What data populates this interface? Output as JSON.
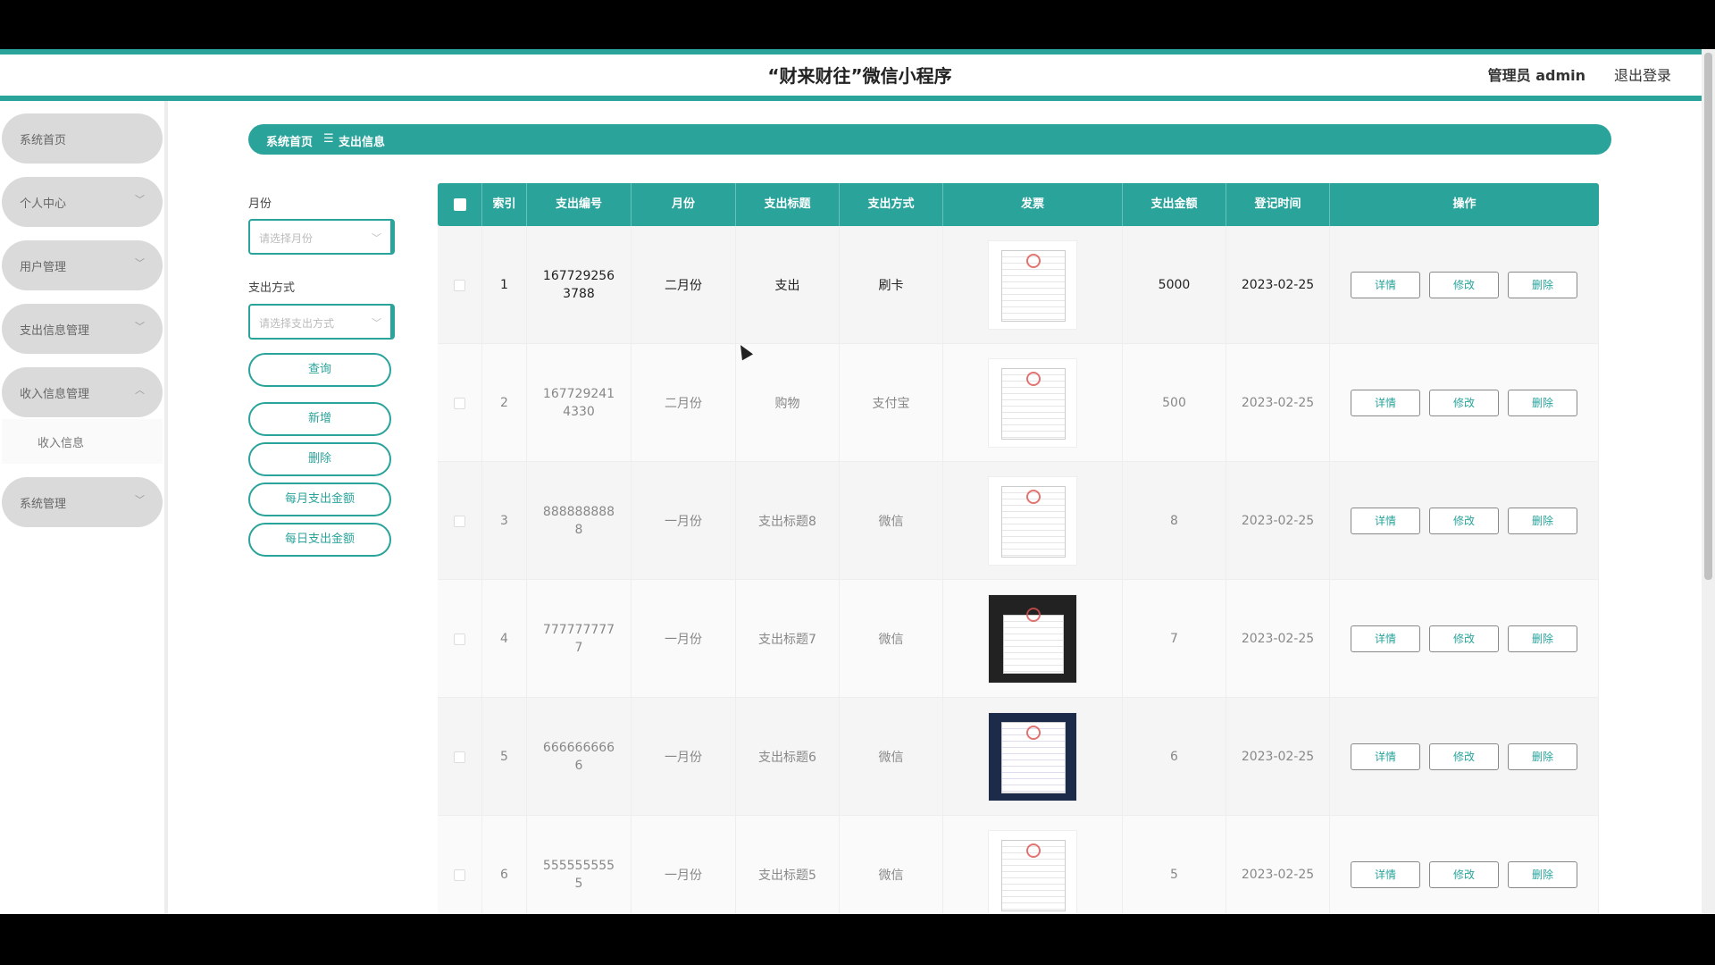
{
  "header": {
    "title": "“财来财往”微信小程序",
    "admin": "管理员 admin",
    "logout": "退出登录"
  },
  "sidebar": {
    "items": [
      {
        "label": "系统首页",
        "chevron": ""
      },
      {
        "label": "个人中心",
        "chevron": "﹀"
      },
      {
        "label": "用户管理",
        "chevron": "﹀"
      },
      {
        "label": "支出信息管理",
        "chevron": "﹀"
      },
      {
        "label": "收入信息管理",
        "chevron": "︿"
      },
      {
        "label": "系统管理",
        "chevron": "﹀"
      }
    ],
    "sub": {
      "label": "收入信息"
    }
  },
  "breadcrumb": {
    "home": "系统首页",
    "sep": "☰",
    "current": "支出信息"
  },
  "filters": {
    "month_label": "月份",
    "month_placeholder": "请选择月份",
    "method_label": "支出方式",
    "method_placeholder": "请选择支出方式",
    "arrow": "﹀",
    "buttons": {
      "query": "查询",
      "add": "新增",
      "delete": "删除",
      "monthly": "每月支出金额",
      "daily": "每日支出金额"
    }
  },
  "table": {
    "headers": {
      "index": "索引",
      "number": "支出编号",
      "month": "月份",
      "title": "支出标题",
      "method": "支出方式",
      "invoice": "发票",
      "amount": "支出金额",
      "time": "登记时间",
      "actions": "操作"
    },
    "actions": {
      "detail": "详情",
      "edit": "修改",
      "delete": "删除"
    },
    "rows": [
      {
        "index": "1",
        "number": "1677292563788",
        "month": "二月份",
        "title": "支出",
        "method": "刷卡",
        "invoice_icon": "invoice-image",
        "amount": "5000",
        "time": "2023-02-25"
      },
      {
        "index": "2",
        "number": "1677292414330",
        "month": "二月份",
        "title": "购物",
        "method": "支付宝",
        "invoice_icon": "invoice-image",
        "amount": "500",
        "time": "2023-02-25"
      },
      {
        "index": "3",
        "number": "8888888888",
        "month": "一月份",
        "title": "支出标题8",
        "method": "微信",
        "invoice_icon": "invoice-image",
        "amount": "8",
        "time": "2023-02-25"
      },
      {
        "index": "4",
        "number": "7777777777",
        "month": "一月份",
        "title": "支出标题7",
        "method": "微信",
        "invoice_icon": "invoice-photo",
        "amount": "7",
        "time": "2023-02-25"
      },
      {
        "index": "5",
        "number": "6666666666",
        "month": "一月份",
        "title": "支出标题6",
        "method": "微信",
        "invoice_icon": "invoice-dark",
        "amount": "6",
        "time": "2023-02-25"
      },
      {
        "index": "6",
        "number": "5555555555",
        "month": "一月份",
        "title": "支出标题5",
        "method": "微信",
        "invoice_icon": "invoice-image",
        "amount": "5",
        "time": "2023-02-25"
      }
    ]
  },
  "colors": {
    "accent": "#2aa39b"
  }
}
